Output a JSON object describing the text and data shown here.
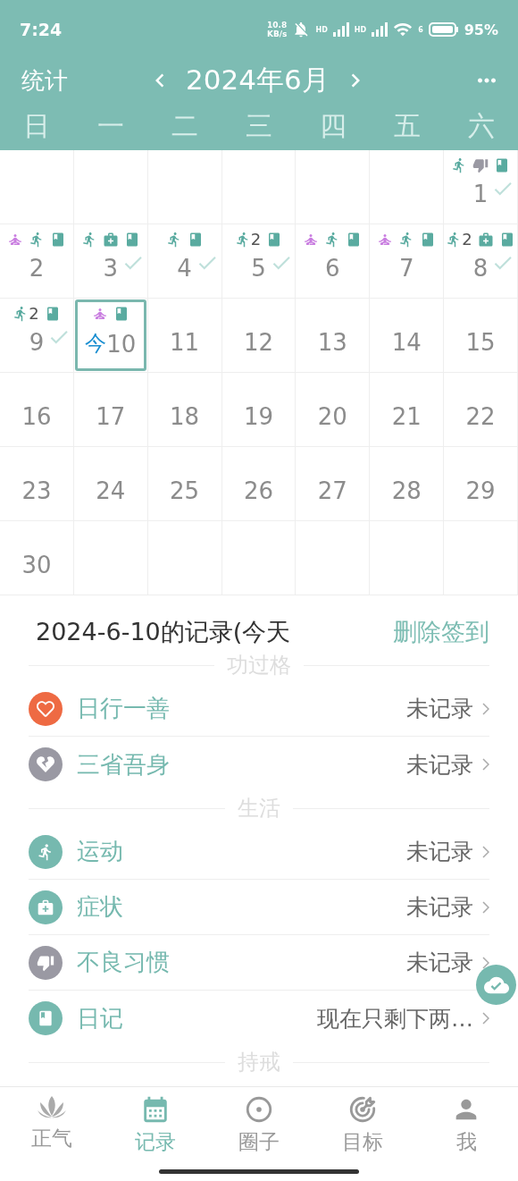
{
  "status_bar": {
    "time": "7:24",
    "speed_value": "10.8",
    "speed_unit": "KB/s",
    "signals": [
      {
        "label": "HD"
      },
      {
        "label": "HD"
      }
    ],
    "wifi_label": "6",
    "battery": "95%"
  },
  "header": {
    "left_label": "统计",
    "title": "2024年6月"
  },
  "calendar": {
    "weekdays": [
      "日",
      "一",
      "二",
      "三",
      "四",
      "五",
      "六"
    ],
    "weeks": [
      [
        {
          "kind": "blank"
        },
        {
          "kind": "blank"
        },
        {
          "kind": "blank"
        },
        {
          "kind": "blank"
        },
        {
          "kind": "blank"
        },
        {
          "kind": "blank"
        },
        {
          "kind": "day",
          "day": "1",
          "checked": true,
          "today": false,
          "marks": [
            {
              "kind": "run"
            },
            {
              "kind": "bad_habit"
            },
            {
              "kind": "diary"
            }
          ]
        }
      ],
      [
        {
          "kind": "day",
          "day": "2",
          "checked": false,
          "today": false,
          "marks": [
            {
              "kind": "meditation"
            },
            {
              "kind": "run"
            },
            {
              "kind": "diary"
            }
          ]
        },
        {
          "kind": "day",
          "day": "3",
          "checked": true,
          "today": false,
          "marks": [
            {
              "kind": "run"
            },
            {
              "kind": "medical"
            },
            {
              "kind": "diary"
            }
          ]
        },
        {
          "kind": "day",
          "day": "4",
          "checked": true,
          "today": false,
          "marks": [
            {
              "kind": "run"
            },
            {
              "kind": "diary"
            }
          ]
        },
        {
          "kind": "day",
          "day": "5",
          "checked": true,
          "today": false,
          "marks": [
            {
              "kind": "run",
              "count": "2"
            },
            {
              "kind": "diary"
            }
          ]
        },
        {
          "kind": "day",
          "day": "6",
          "checked": false,
          "today": false,
          "marks": [
            {
              "kind": "meditation"
            },
            {
              "kind": "run"
            },
            {
              "kind": "diary"
            }
          ]
        },
        {
          "kind": "day",
          "day": "7",
          "checked": false,
          "today": false,
          "marks": [
            {
              "kind": "meditation"
            },
            {
              "kind": "run"
            },
            {
              "kind": "diary"
            }
          ]
        },
        {
          "kind": "day",
          "day": "8",
          "checked": true,
          "today": false,
          "marks": [
            {
              "kind": "run",
              "count": "2"
            },
            {
              "kind": "medical"
            },
            {
              "kind": "diary"
            }
          ]
        }
      ],
      [
        {
          "kind": "day",
          "day": "9",
          "checked": true,
          "today": false,
          "marks": [
            {
              "kind": "run",
              "count": "2"
            },
            {
              "kind": "diary"
            }
          ]
        },
        {
          "kind": "day",
          "day": "10",
          "checked": false,
          "today": true,
          "today_label": "今",
          "marks": [
            {
              "kind": "meditation"
            },
            {
              "kind": "diary"
            }
          ]
        },
        {
          "kind": "day",
          "day": "11",
          "checked": false,
          "today": false
        },
        {
          "kind": "day",
          "day": "12",
          "checked": false,
          "today": false
        },
        {
          "kind": "day",
          "day": "13",
          "checked": false,
          "today": false
        },
        {
          "kind": "day",
          "day": "14",
          "checked": false,
          "today": false
        },
        {
          "kind": "day",
          "day": "15",
          "checked": false,
          "today": false
        }
      ],
      [
        {
          "kind": "day",
          "day": "16",
          "checked": false,
          "today": false
        },
        {
          "kind": "day",
          "day": "17",
          "checked": false,
          "today": false
        },
        {
          "kind": "day",
          "day": "18",
          "checked": false,
          "today": false
        },
        {
          "kind": "day",
          "day": "19",
          "checked": false,
          "today": false
        },
        {
          "kind": "day",
          "day": "20",
          "checked": false,
          "today": false
        },
        {
          "kind": "day",
          "day": "21",
          "checked": false,
          "today": false
        },
        {
          "kind": "day",
          "day": "22",
          "checked": false,
          "today": false
        }
      ],
      [
        {
          "kind": "day",
          "day": "23",
          "checked": false,
          "today": false
        },
        {
          "kind": "day",
          "day": "24",
          "checked": false,
          "today": false
        },
        {
          "kind": "day",
          "day": "25",
          "checked": false,
          "today": false
        },
        {
          "kind": "day",
          "day": "26",
          "checked": false,
          "today": false
        },
        {
          "kind": "day",
          "day": "27",
          "checked": false,
          "today": false
        },
        {
          "kind": "day",
          "day": "28",
          "checked": false,
          "today": false
        },
        {
          "kind": "day",
          "day": "29",
          "checked": false,
          "today": false
        }
      ],
      [
        {
          "kind": "day",
          "day": "30",
          "checked": false,
          "today": false
        },
        {
          "kind": "blank"
        },
        {
          "kind": "blank"
        },
        {
          "kind": "blank"
        },
        {
          "kind": "blank"
        },
        {
          "kind": "blank"
        },
        {
          "kind": "blank"
        }
      ]
    ]
  },
  "records": {
    "title": "2024-6-10的记录(今天",
    "action": "删除签到",
    "sections": [
      {
        "title": "功过格",
        "items": [
          {
            "kind": "heart",
            "color": "#ee6a43",
            "label": "日行一善",
            "value": "未记录"
          },
          {
            "kind": "broken_heart",
            "color": "#9a99a3",
            "label": "三省吾身",
            "value": "未记录"
          }
        ]
      },
      {
        "title": "生活",
        "items": [
          {
            "kind": "run",
            "color": "#76b9af",
            "label": "运动",
            "value": "未记录"
          },
          {
            "kind": "medical",
            "color": "#76b9af",
            "label": "症状",
            "value": "未记录"
          },
          {
            "kind": "bad_habit",
            "color": "#9a99a3",
            "label": "不良习惯",
            "value": "未记录"
          },
          {
            "kind": "diary",
            "color": "#76b9af",
            "label": "日记",
            "value": "现在只剩下两…"
          }
        ]
      },
      {
        "title": "持戒"
      }
    ]
  },
  "tab_bar": [
    {
      "kind": "lotus",
      "label": "正气",
      "selected": false
    },
    {
      "kind": "calendar",
      "label": "记录",
      "selected": true
    },
    {
      "kind": "circle",
      "label": "圈子",
      "selected": false
    },
    {
      "kind": "target",
      "label": "目标",
      "selected": false
    },
    {
      "kind": "person",
      "label": "我",
      "selected": false
    }
  ]
}
